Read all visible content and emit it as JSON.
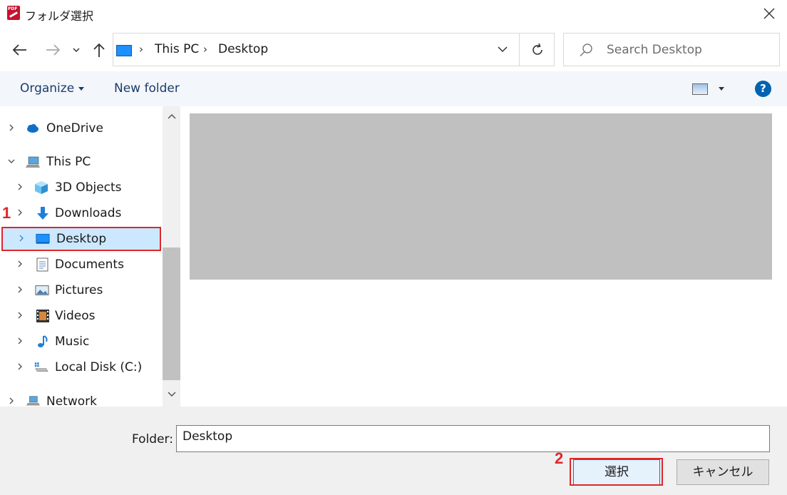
{
  "window": {
    "title": "フォルダ選択"
  },
  "address_bar": {
    "crumbs": [
      "This PC",
      "Desktop"
    ]
  },
  "search": {
    "placeholder": "Search Desktop"
  },
  "toolbar": {
    "organize_label": "Organize",
    "new_folder_label": "New folder"
  },
  "nav": {
    "items": [
      {
        "label": "OneDrive",
        "icon": "cloud-icon"
      },
      {
        "label": "This PC",
        "icon": "computer-icon"
      },
      {
        "label": "3D Objects",
        "icon": "cube-icon"
      },
      {
        "label": "Downloads",
        "icon": "download-arrow-icon"
      },
      {
        "label": "Desktop",
        "icon": "desktop-icon",
        "selected": true
      },
      {
        "label": "Documents",
        "icon": "document-icon"
      },
      {
        "label": "Pictures",
        "icon": "pictures-icon"
      },
      {
        "label": "Videos",
        "icon": "film-icon"
      },
      {
        "label": "Music",
        "icon": "music-note-icon"
      },
      {
        "label": "Local Disk (C:)",
        "icon": "disk-icon"
      },
      {
        "label": "Network",
        "icon": "network-icon"
      }
    ]
  },
  "footer": {
    "folder_label": "Folder:",
    "folder_value": "Desktop",
    "select_label": "選択",
    "cancel_label": "キャンセル"
  },
  "annotations": {
    "step1": "1",
    "step2": "2"
  },
  "colors": {
    "highlight_red": "#e0262a",
    "selection_bg": "#cce8ff",
    "accent_blue": "#0078d7"
  }
}
